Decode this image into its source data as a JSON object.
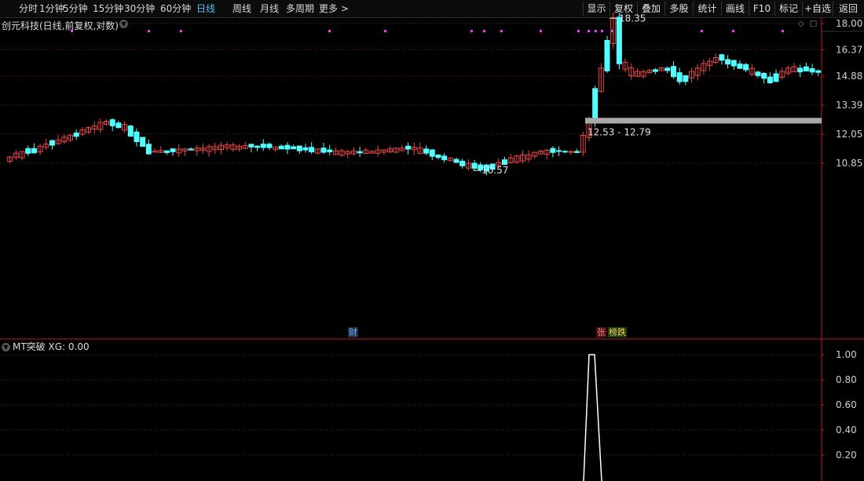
{
  "toolbar": {
    "left_tabs": [
      "分时",
      "1分钟",
      "5分钟",
      "15分钟",
      "30分钟",
      "60分钟",
      "日线",
      "周线",
      "月线",
      "多周期",
      "更多 >"
    ],
    "active_tab": "日线",
    "right_buttons": [
      "显示",
      "复权",
      "叠加",
      "多股",
      "统计",
      "画线",
      "F10",
      "标记",
      "+自选",
      "返回"
    ]
  },
  "main_panel": {
    "title": "创元科技(日线,前复权,对数)",
    "price_labels": [
      "18.00",
      "16.37",
      "14.88",
      "13.39",
      "12.05",
      "10.85"
    ],
    "high_label": "18.35",
    "low_label": "10.57",
    "zone_label": "12.53 - 12.79",
    "tags": {
      "finance": "财",
      "limit_up": "张",
      "dragon_tiger": "榜跌"
    }
  },
  "indicator_panel": {
    "title": "MT突破 XG: 0.00",
    "labels": [
      "1.00",
      "0.80",
      "0.60",
      "0.40",
      "0.20"
    ]
  },
  "colors": {
    "up": "#e84545",
    "down": "#54ffff",
    "grid": "#7a1f1f",
    "axis": "#b02020",
    "signal": "#ffffff",
    "zone": "#a8a8a8",
    "marker": "#ff30ff",
    "active_tab": "#4fc3f7"
  },
  "chart_data": {
    "type": "candlestick",
    "title": "创元科技(日线,前复权,对数)",
    "y_scale": "log",
    "ylim": [
      10.5,
      18.6
    ],
    "yticks": [
      18.0,
      16.37,
      14.88,
      13.39,
      12.05,
      10.85
    ],
    "annotations": [
      {
        "text": "18.35",
        "price": 18.35
      },
      {
        "text": "10.57",
        "price": 10.57
      },
      {
        "text": "12.53 - 12.79",
        "from": 12.53,
        "to": 12.79
      }
    ],
    "indicator": {
      "name": "MT突破",
      "value_label": "XG: 0.00",
      "ylim": [
        0,
        1.0
      ],
      "yticks": [
        1.0,
        0.8,
        0.6,
        0.4,
        0.2
      ],
      "signal_peak": 1.0
    }
  }
}
